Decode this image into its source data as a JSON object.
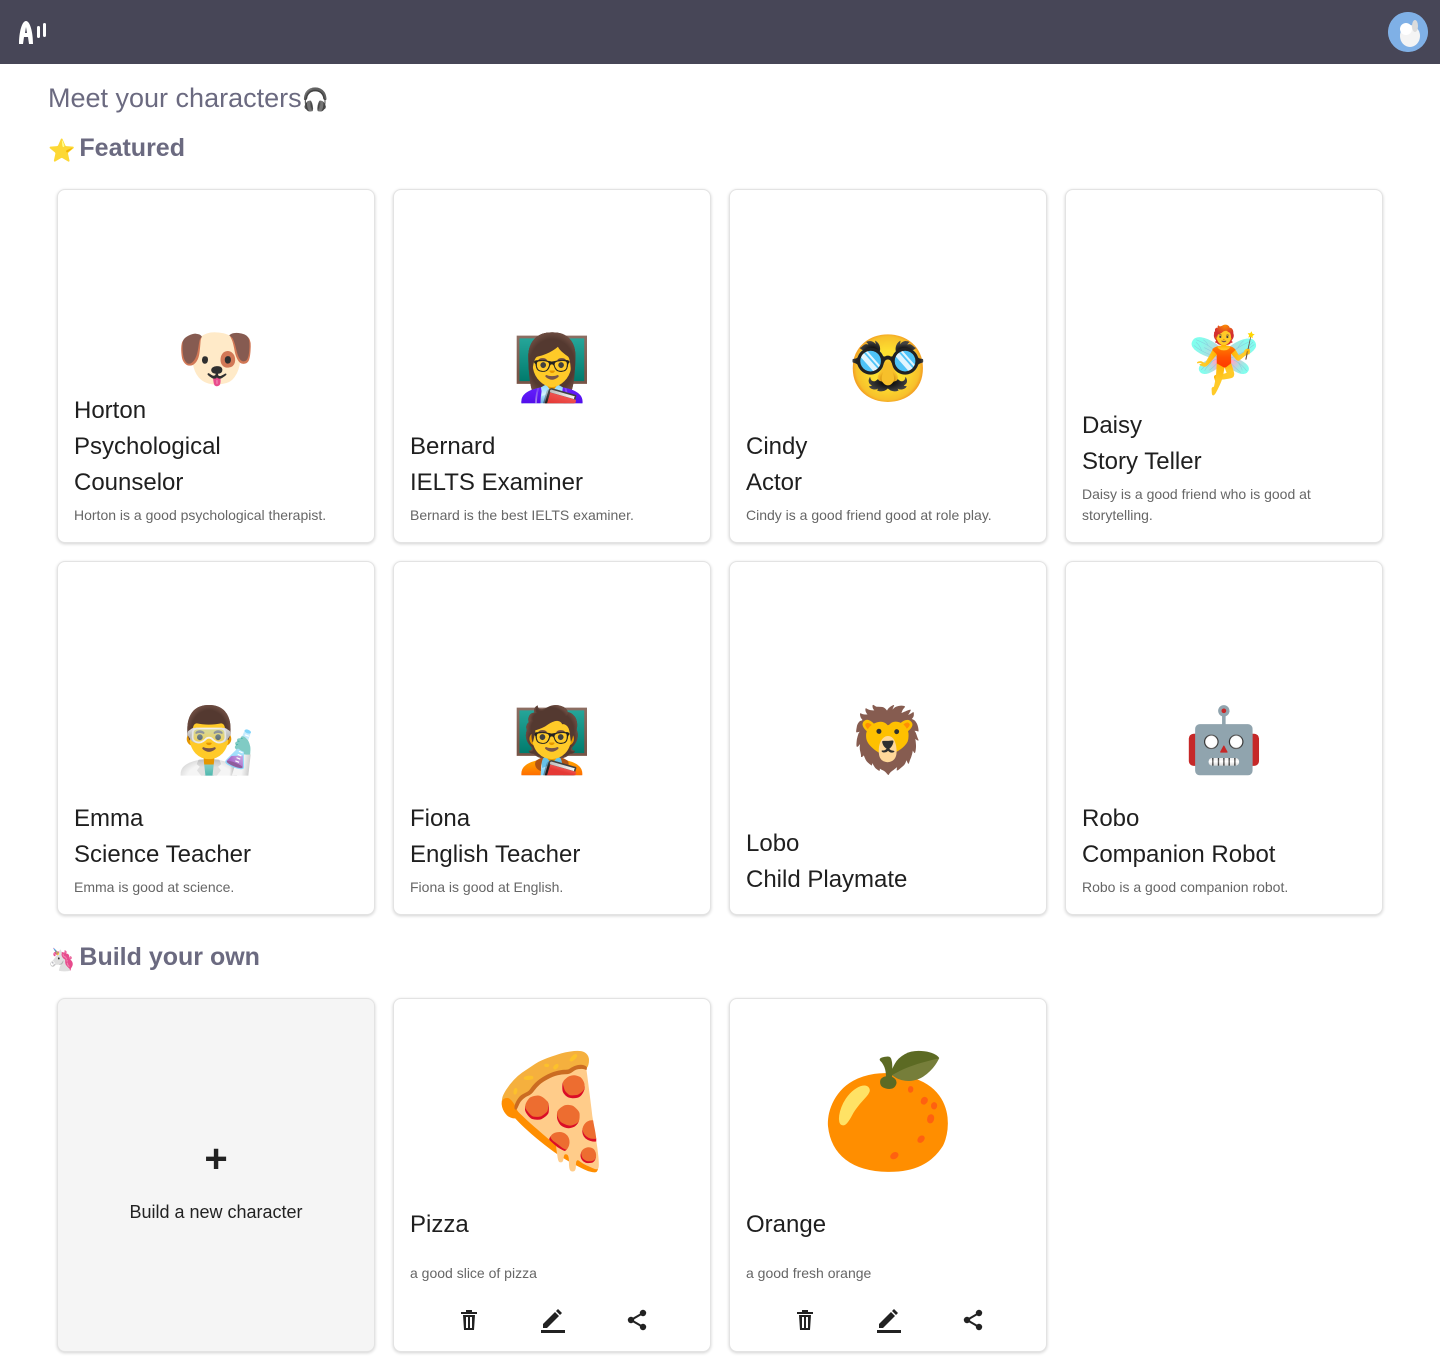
{
  "page": {
    "title": "Meet your characters",
    "title_emoji": "🎧"
  },
  "sections": {
    "featured": {
      "emoji": "⭐",
      "title": "Featured"
    },
    "build": {
      "emoji": "🦄",
      "title": "Build your own"
    }
  },
  "featured": [
    {
      "emoji": "🐶",
      "name": "Horton",
      "role": "Psychological Counselor",
      "description": "Horton is a good psychological therapist."
    },
    {
      "emoji": "👩‍🏫",
      "name": "Bernard",
      "role": "IELTS Examiner",
      "description": "Bernard is the best IELTS examiner."
    },
    {
      "emoji": "🥸",
      "name": "Cindy",
      "role": "Actor",
      "description": "Cindy is a good friend good at role play."
    },
    {
      "emoji": "🧚",
      "name": "Daisy",
      "role": "Story Teller",
      "description": "Daisy is a good friend who is good at storytelling."
    },
    {
      "emoji": "👨‍🔬",
      "name": "Emma",
      "role": "Science Teacher",
      "description": "Emma is good at science."
    },
    {
      "emoji": "🧑‍🏫",
      "name": "Fiona",
      "role": "English Teacher",
      "description": "Fiona is good at English."
    },
    {
      "emoji": "🦁",
      "name": "Lobo",
      "role": "Child Playmate",
      "description": ""
    },
    {
      "emoji": "🤖",
      "name": "Robo",
      "role": "Companion Robot",
      "description": "Robo is a good companion robot."
    }
  ],
  "build_new": {
    "icon": "+",
    "label": "Build a new character"
  },
  "custom": [
    {
      "emoji": "🍕",
      "name": "Pizza",
      "description": "a good slice of pizza"
    },
    {
      "emoji": "🍊",
      "name": "Orange",
      "description": "a good fresh orange"
    }
  ],
  "icons": {
    "logo": "logo-icon",
    "avatar": "avatar-icon",
    "delete": "trash-icon",
    "edit": "pencil-icon",
    "share": "share-icon"
  },
  "colors": {
    "topbar": "#474657",
    "heading": "#6b6a80",
    "build_card_bg": "#f5f5f5"
  }
}
